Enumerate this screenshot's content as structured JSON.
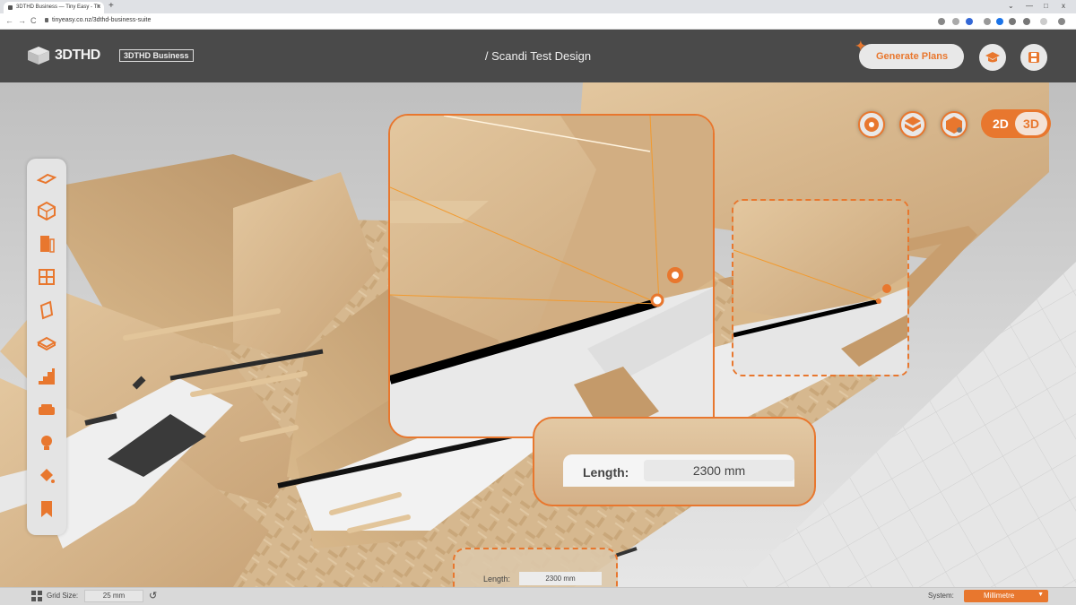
{
  "browser": {
    "tab_title": "3DTHD Business — Tiny Easy - Th",
    "tab_close": "x",
    "new_tab": "+",
    "url": "tinyeasy.co.nz/3dthd-business-suite",
    "back": "←",
    "forward": "→",
    "reload": "C",
    "win_minimize": "—",
    "win_maximize": "□",
    "win_close": "x",
    "chevron": "⌄"
  },
  "header": {
    "logo": "3DTHD",
    "badge": "3DTHD Business",
    "title": "/ Scandi Test Design",
    "generate_label": "Generate Plans",
    "academy_icon": "graduation-cap-icon",
    "save_icon": "save-icon"
  },
  "view": {
    "mode_2d": "2D",
    "mode_3d": "3D",
    "active_mode": "3D"
  },
  "measure": {
    "label": "Length:",
    "value": "2300 mm"
  },
  "toolbar": {
    "items": [
      "floor-icon",
      "cube-icon",
      "door-icon",
      "window-icon",
      "wall-panel-icon",
      "slab-icon",
      "stairs-icon",
      "sofa-icon",
      "light-bulb-icon",
      "paint-bucket-icon",
      "bookmark-icon"
    ]
  },
  "status": {
    "grid_label": "Grid Size:",
    "grid_value": "25 mm",
    "system_label": "System:",
    "system_value": "Millimetre"
  },
  "colors": {
    "accent": "#e8772e",
    "header_bg": "#4a4a4a",
    "wood": "#d9b98c"
  }
}
